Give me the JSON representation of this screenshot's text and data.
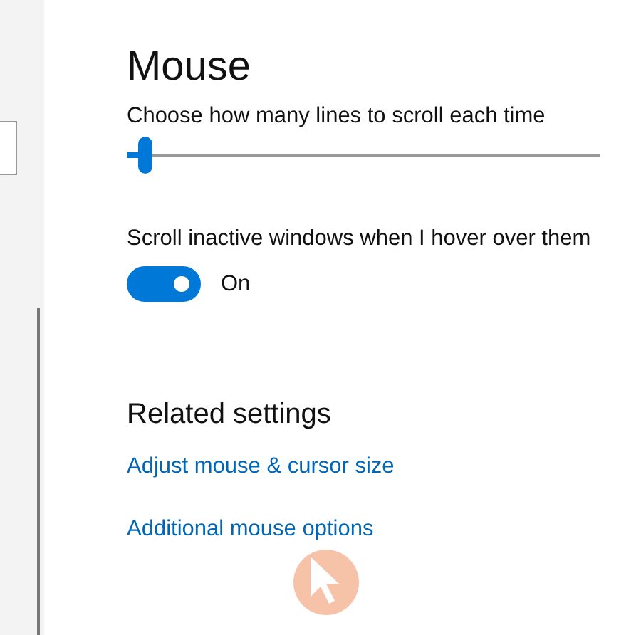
{
  "page": {
    "title": "Mouse"
  },
  "scroll_lines": {
    "label": "Choose how many lines to scroll each time",
    "level": 0.04
  },
  "scroll_inactive": {
    "label": "Scroll inactive windows when I hover over them",
    "on": true,
    "state_text": "On"
  },
  "related_settings": {
    "title": "Related settings",
    "links": [
      "Adjust mouse & cursor size",
      "Additional mouse options"
    ]
  }
}
